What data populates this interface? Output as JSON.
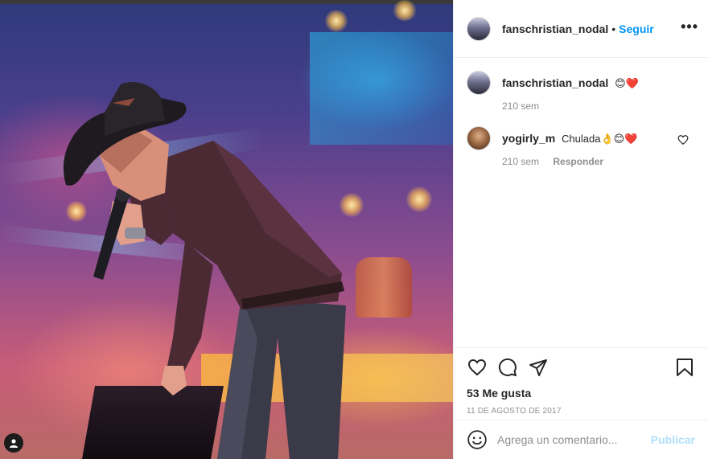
{
  "post": {
    "author": "fanschristian_nodal",
    "follow_label": "Seguir",
    "separator": "•",
    "more_label": "•••",
    "caption": {
      "user": "fanschristian_nodal",
      "text": "😊❤️",
      "time": "210 sem"
    },
    "comments": [
      {
        "user": "yogirly_m",
        "text": "Chulada👌😊❤️",
        "time": "210 sem",
        "reply_label": "Responder"
      }
    ],
    "likes": "53 Me gusta",
    "date": "11 DE AGOSTO DE 2017",
    "comment_placeholder": "Agrega un comentario...",
    "publish_label": "Publicar"
  },
  "icons": {
    "more": "more-horizontal-icon",
    "like": "heart-outline-icon",
    "comment": "comment-bubble-icon",
    "share": "paper-plane-icon",
    "save": "bookmark-icon",
    "emoji": "smiley-icon",
    "tag": "user-tag-icon"
  },
  "colors": {
    "accent": "#0095f6",
    "publish_disabled": "#b2dffc",
    "muted": "#8e8e8e",
    "text": "#262626",
    "border": "#efefef"
  }
}
